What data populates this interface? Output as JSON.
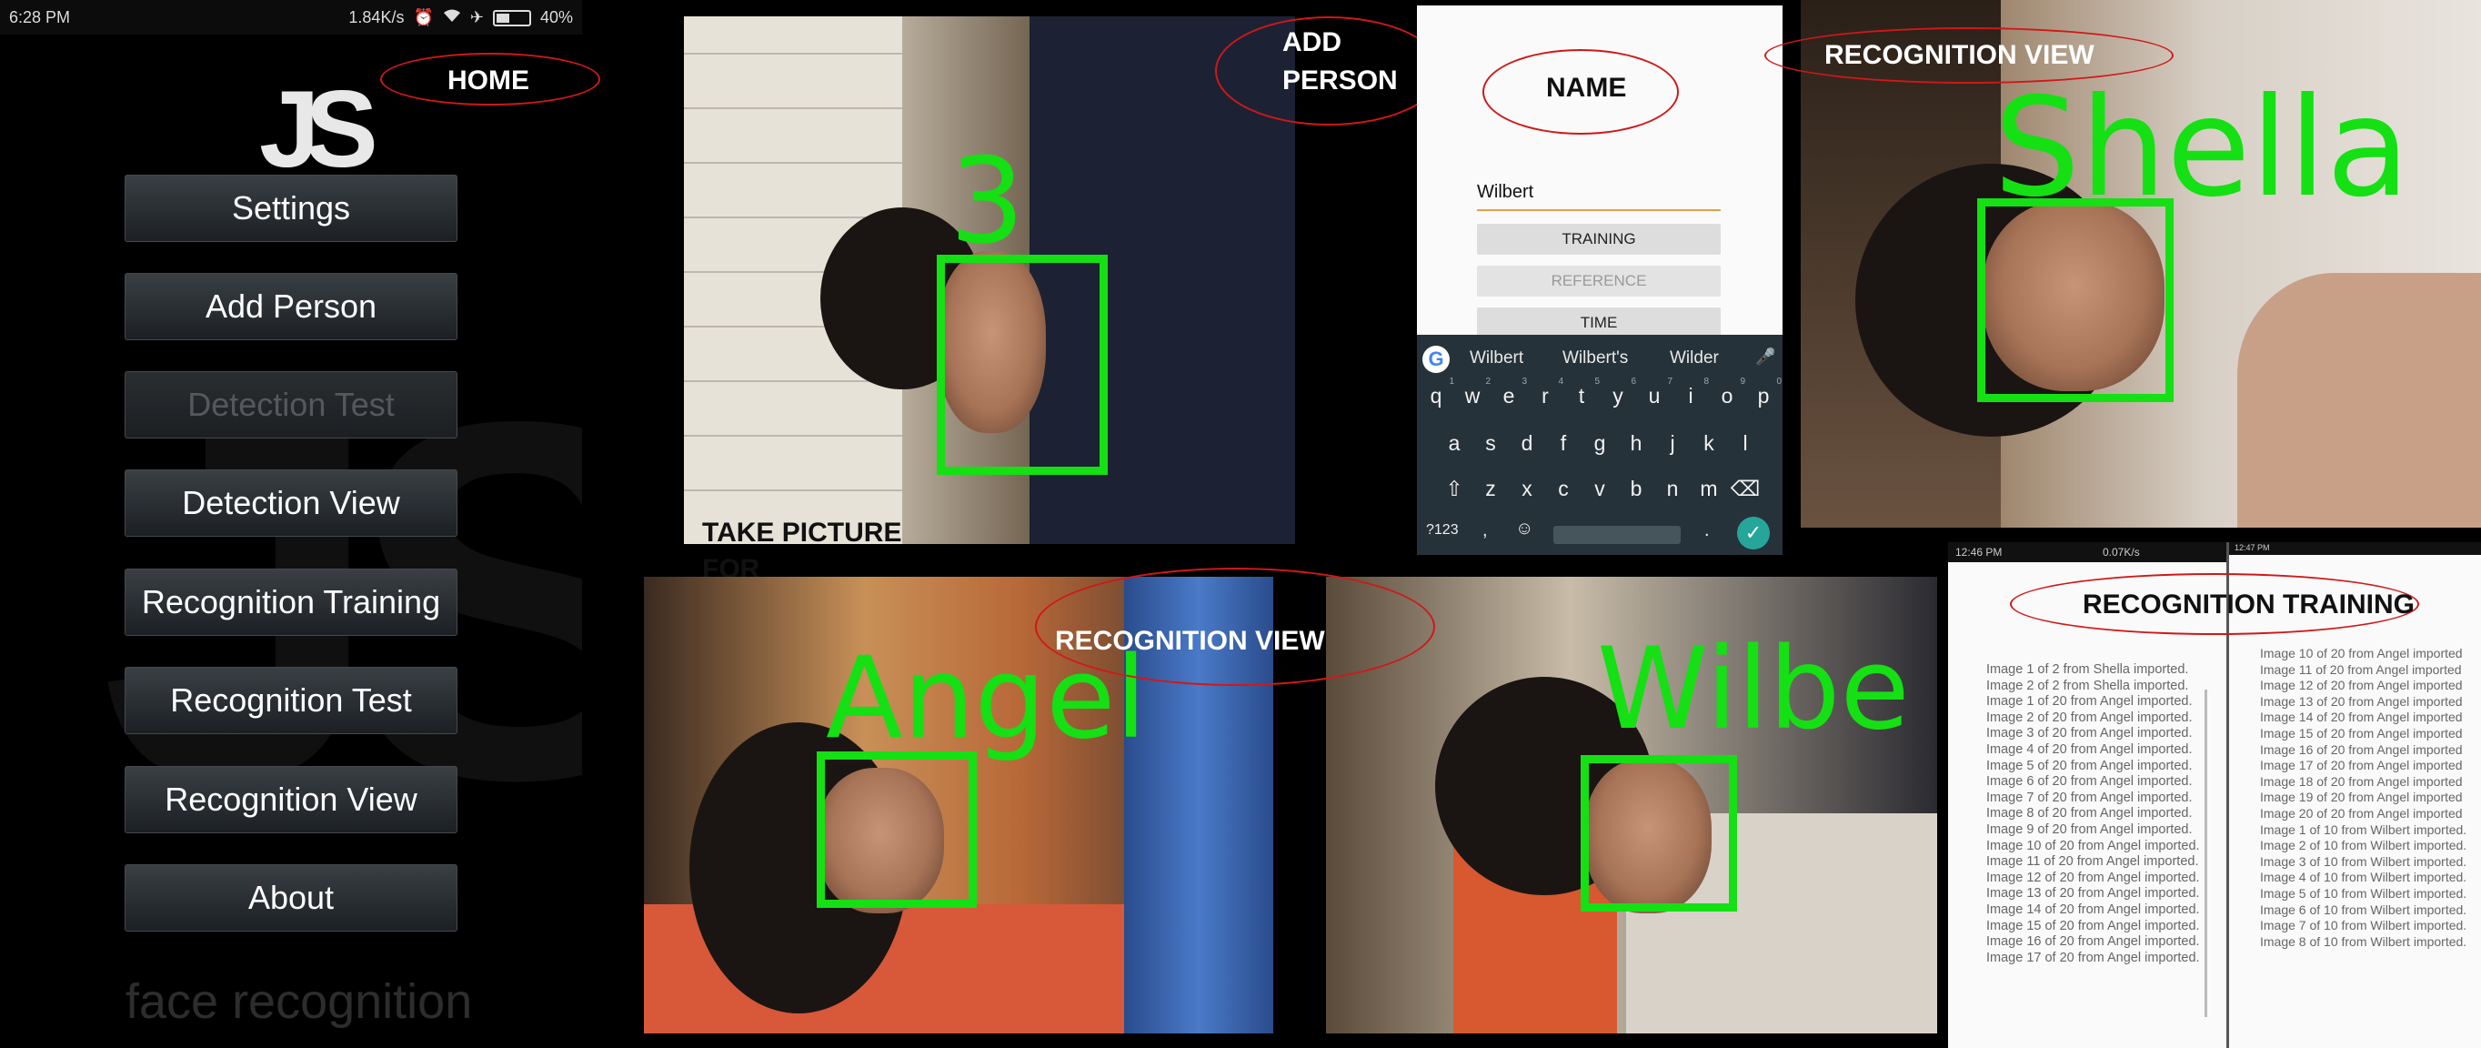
{
  "status_bar": {
    "time": "6:28 PM",
    "speed": "1.84K/s",
    "battery": "40%",
    "icons": [
      "alarm-icon",
      "wifi-icon",
      "airplane-icon",
      "battery-icon"
    ]
  },
  "home": {
    "logo": "JS",
    "menu": [
      {
        "label": "Settings",
        "enabled": true
      },
      {
        "label": "Add Person",
        "enabled": true
      },
      {
        "label": "Detection Test",
        "enabled": false
      },
      {
        "label": "Detection View",
        "enabled": true
      },
      {
        "label": "Recognition Training",
        "enabled": true
      },
      {
        "label": "Recognition Test",
        "enabled": true
      },
      {
        "label": "Recognition View",
        "enabled": true
      },
      {
        "label": "About",
        "enabled": true
      }
    ],
    "footer": "face recognition"
  },
  "annotations": {
    "home": "HOME",
    "add_person_line1": "ADD",
    "add_person_line2": "PERSON",
    "name": "NAME",
    "recognition_view_top": "RECOGNITION VIEW",
    "take_picture_line1": "TAKE PICTURE",
    "take_picture_line2": "FOR",
    "recognition_view_bottom": "RECOGNITION VIEW",
    "recognition_training": "RECOGNITION TRAINING"
  },
  "captures": {
    "take_picture_label": "3",
    "recognition_top_label": "Shella",
    "recognition_bottom_left_label": "Angel",
    "recognition_bottom_right_label": "Wilbe"
  },
  "add_person_form": {
    "name_value": "Wilbert",
    "buttons": [
      {
        "label": "TRAINING",
        "enabled": true
      },
      {
        "label": "REFERENCE",
        "enabled": false
      },
      {
        "label": "TIME",
        "enabled": true
      }
    ],
    "keyboard": {
      "suggestions": [
        "Wilbert",
        "Wilbert's",
        "Wilder"
      ],
      "row1": [
        "q",
        "w",
        "e",
        "r",
        "t",
        "y",
        "u",
        "i",
        "o",
        "p"
      ],
      "row1_hints": [
        "1",
        "2",
        "3",
        "4",
        "5",
        "6",
        "7",
        "8",
        "9",
        "0"
      ],
      "row2": [
        "a",
        "s",
        "d",
        "f",
        "g",
        "h",
        "j",
        "k",
        "l"
      ],
      "row3": [
        "z",
        "x",
        "c",
        "v",
        "b",
        "n",
        "m"
      ],
      "symbols_key": "?123",
      "comma": ",",
      "period": "."
    }
  },
  "training_log_left": {
    "time": "12:46 PM",
    "speed": "0.07K/s",
    "lines": [
      "Image 1 of 2 from Shella imported.",
      "Image 2 of 2 from Shella imported.",
      "Image 1 of 20 from Angel imported.",
      "Image 2 of 20 from Angel imported.",
      "Image 3 of 20 from Angel imported.",
      "Image 4 of 20 from Angel imported.",
      "Image 5 of 20 from Angel imported.",
      "Image 6 of 20 from Angel imported.",
      "Image 7 of 20 from Angel imported.",
      "Image 8 of 20 from Angel imported.",
      "Image 9 of 20 from Angel imported.",
      "Image 10 of 20 from Angel imported.",
      "Image 11 of 20 from Angel imported.",
      "Image 12 of 20 from Angel imported.",
      "Image 13 of 20 from Angel imported.",
      "Image 14 of 20 from Angel imported.",
      "Image 15 of 20 from Angel imported.",
      "Image 16 of 20 from Angel imported.",
      "Image 17 of 20 from Angel imported."
    ]
  },
  "training_log_right": {
    "time": "12:47 PM",
    "lines": [
      "Image 10 of 20 from Angel imported",
      "Image 11 of 20 from Angel imported",
      "Image 12 of 20 from Angel imported",
      "Image 13 of 20 from Angel imported",
      "Image 14 of 20 from Angel imported",
      "Image 15 of 20 from Angel imported",
      "Image 16 of 20 from Angel imported",
      "Image 17 of 20 from Angel imported",
      "Image 18 of 20 from Angel imported",
      "Image 19 of 20 from Angel imported",
      "Image 20 of 20 from Angel imported",
      "Image 1 of 10 from Wilbert imported.",
      "Image 2 of 10 from Wilbert imported.",
      "Image 3 of 10 from Wilbert imported.",
      "Image 4 of 10 from Wilbert imported.",
      "Image 5 of 10 from Wilbert imported.",
      "Image 6 of 10 from Wilbert imported.",
      "Image 7 of 10 from Wilbert imported.",
      "Image 8 of 10 from Wilbert imported."
    ]
  },
  "colors": {
    "detection_green": "#14e014",
    "annotation_red": "#d01818",
    "button_dark": "#2a2f33",
    "keyboard_bg": "#26323a",
    "accent_teal": "#26a69a"
  }
}
